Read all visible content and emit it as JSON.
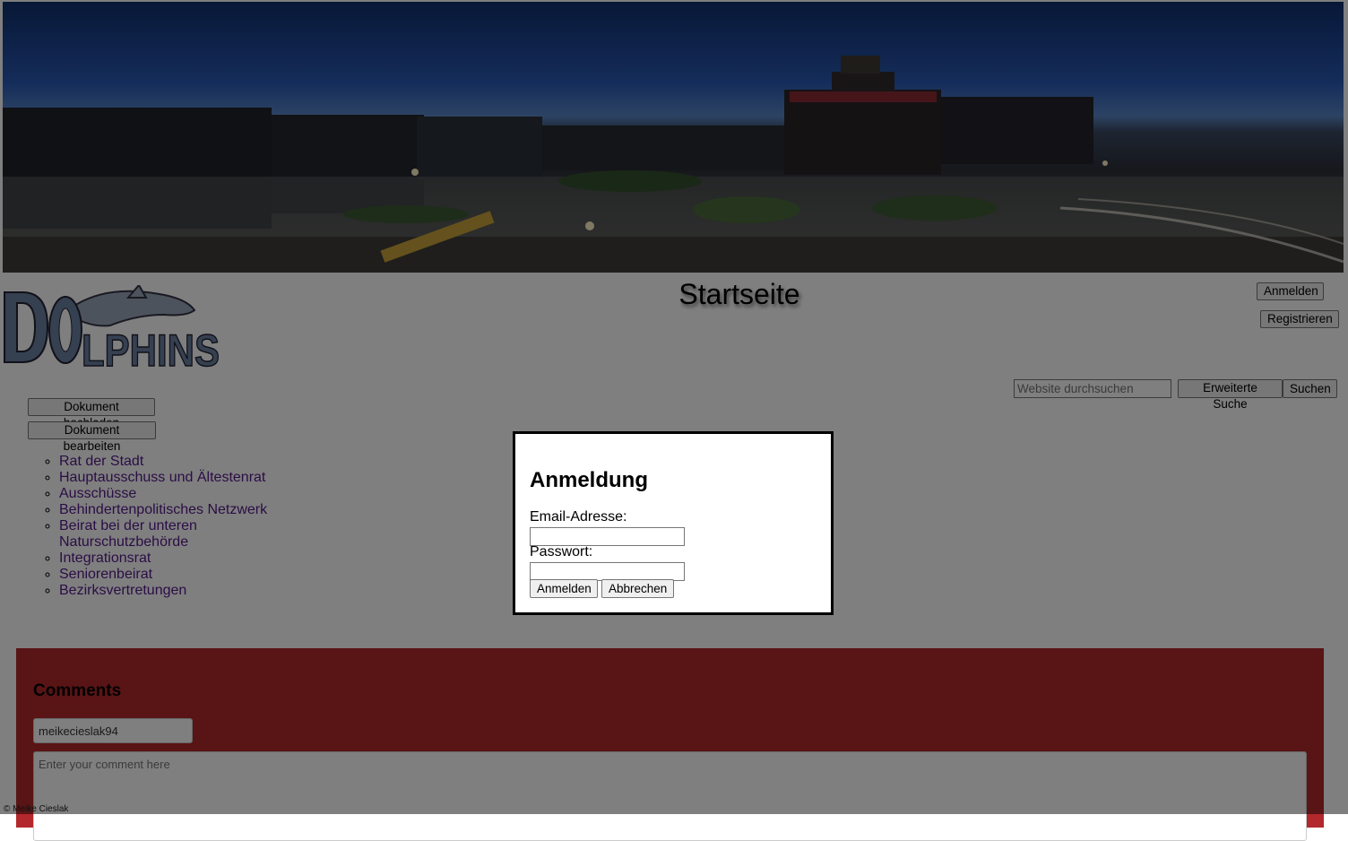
{
  "header": {
    "page_title": "Startseite",
    "login_button": "Anmelden",
    "register_button": "Registrieren",
    "logo_text": "DOLPHINS"
  },
  "search": {
    "placeholder": "Website durchsuchen",
    "advanced_button": "Erweiterte Suche",
    "search_button": "Suchen"
  },
  "documents": {
    "upload_button": "Dokument hochladen",
    "edit_button": "Dokument bearbeiten"
  },
  "committees": [
    {
      "label": "Rat der Stadt"
    },
    {
      "label": "Hauptausschuss und Ältestenrat"
    },
    {
      "label": "Ausschüsse"
    },
    {
      "label": "Behindertenpolitisches Netzwerk"
    },
    {
      "label": "Beirat bei der unteren Naturschutzbehörde"
    },
    {
      "label": "Integrationsrat"
    },
    {
      "label": "Seniorenbeirat"
    },
    {
      "label": "Bezirksvertretungen"
    }
  ],
  "comments": {
    "title": "Comments",
    "username": "meikecieslak94",
    "comment_placeholder": "Enter your comment here"
  },
  "footer": {
    "copyright": "© Meike Cieslak"
  },
  "modal": {
    "title": "Anmeldung",
    "email_label": "Email-Adresse:",
    "password_label": "Passwort:",
    "login_button": "Anmelden",
    "cancel_button": "Abbrechen"
  },
  "colors": {
    "comments_background": "#b3282d",
    "link": "#551a8b",
    "overlay": "rgba(0,0,0,0.5)"
  }
}
